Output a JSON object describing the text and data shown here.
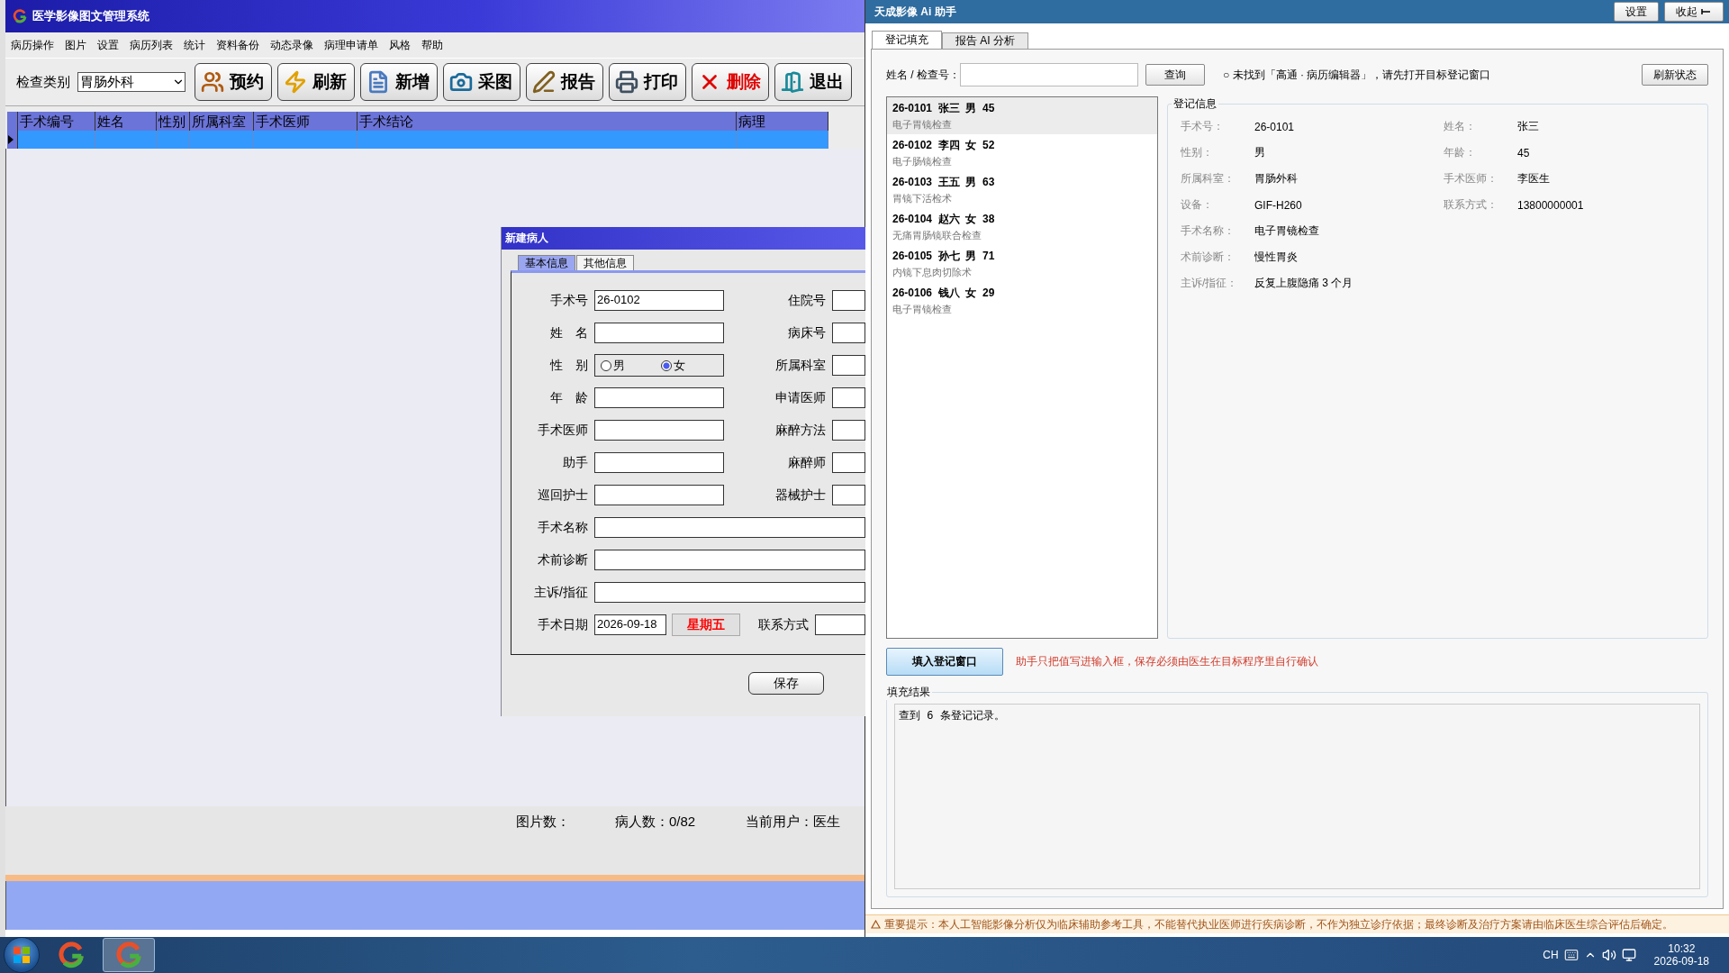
{
  "main_window": {
    "title": "医学影像图文管理系统",
    "menu": [
      "病历操作",
      "图片",
      "设置",
      "病历列表",
      "统计",
      "资料备份",
      "动态录像",
      "病理申请单",
      "风格",
      "帮助"
    ],
    "toolbar": {
      "category_label": "检查类别",
      "category_value": "胃肠外科",
      "buttons": [
        {
          "label": "预约",
          "kind": "appointment"
        },
        {
          "label": "刷新",
          "kind": "refresh"
        },
        {
          "label": "新增",
          "kind": "new"
        },
        {
          "label": "采图",
          "kind": "capture"
        },
        {
          "label": "报告",
          "kind": "report"
        },
        {
          "label": "打印",
          "kind": "print"
        },
        {
          "label": "删除",
          "kind": "delete"
        },
        {
          "label": "退出",
          "kind": "exit"
        }
      ]
    },
    "table": {
      "columns": [
        "手术编号",
        "姓名",
        "性别",
        "所属科室",
        "手术医师",
        "手术结论",
        "病理"
      ],
      "rows": [
        {
          "selected": true
        }
      ]
    },
    "status": [
      "图片数：",
      "病人数：0/82",
      "当前用户：医生"
    ]
  },
  "dialog": {
    "title": "新建病人",
    "tabs": [
      {
        "label": "基本信息",
        "selected": true
      },
      {
        "label": "其他信息",
        "selected": false
      }
    ],
    "rows": [
      {
        "kind": "pair",
        "label": "手术号",
        "value": "26-0102",
        "right": "住院号"
      },
      {
        "kind": "pair",
        "label": "姓　名",
        "right": "病床号"
      },
      {
        "kind": "gender",
        "label": "性　别",
        "options": [
          {
            "label": "男",
            "selected": false
          },
          {
            "label": "女",
            "selected": true
          }
        ],
        "right": "所属科室"
      },
      {
        "kind": "pair",
        "label": "年　龄",
        "right": "申请医师"
      },
      {
        "kind": "pair",
        "label": "手术医师",
        "right": "麻醉方法"
      },
      {
        "kind": "pair",
        "label": "助手",
        "right": "麻醉师"
      },
      {
        "kind": "pair",
        "label": "巡回护士",
        "right": "器械护士"
      },
      {
        "kind": "wide",
        "label": "手术名称"
      },
      {
        "kind": "wide",
        "label": "术前诊断"
      },
      {
        "kind": "wide",
        "label": "主诉/指征"
      },
      {
        "kind": "date",
        "label": "手术日期",
        "value": "2026-09-18",
        "weekday": "星期五",
        "right": "联系方式"
      }
    ],
    "save_button": "保存"
  },
  "assistant": {
    "title": "天成影像 Ai 助手",
    "settings_button": "设置",
    "collapse_button": "收起",
    "tabs": [
      {
        "label": "登记填充",
        "selected": true
      },
      {
        "label": "报告 AI 分析",
        "selected": false
      }
    ],
    "search_label": "姓名 / 检查号：",
    "search_button": "查询",
    "status_text": "○ 未找到「高通 · 病历编辑器」，请先打开目标登记窗口",
    "refresh_button": "刷新状态",
    "records": [
      {
        "title": "26-0101  张三  男  45",
        "exam": "电子胃镜检查",
        "selected": true
      },
      {
        "title": "26-0102  李四  女  52",
        "exam": "电子肠镜检查",
        "selected": false
      },
      {
        "title": "26-0103  王五  男  63",
        "exam": "胃镜下活检术",
        "selected": false
      },
      {
        "title": "26-0104  赵六  女  38",
        "exam": "无痛胃肠镜联合检查",
        "selected": false
      },
      {
        "title": "26-0105  孙七  男  71",
        "exam": "内镜下息肉切除术",
        "selected": false
      },
      {
        "title": "26-0106  钱八  女  29",
        "exam": "电子胃镜检查",
        "selected": false
      }
    ],
    "details": {
      "title": "登记信息",
      "rows": [
        [
          {
            "label": "手术号：",
            "value": "26-0101"
          },
          {
            "label": "姓名：",
            "value": "张三"
          }
        ],
        [
          {
            "label": "性别：",
            "value": "男"
          },
          {
            "label": "年龄：",
            "value": "45"
          }
        ],
        [
          {
            "label": "所属科室：",
            "value": "胃肠外科"
          },
          {
            "label": "手术医师：",
            "value": "李医生"
          }
        ],
        [
          {
            "label": "设备：",
            "value": "GIF-H260"
          },
          {
            "label": "联系方式：",
            "value": "13800000001"
          }
        ],
        [
          {
            "label": "手术名称：",
            "value": "电子胃镜检查"
          }
        ],
        [
          {
            "label": "术前诊断：",
            "value": "慢性胃炎"
          }
        ],
        [
          {
            "label": "主诉/指征：",
            "value": "反复上腹隐痛 3 个月"
          }
        ]
      ]
    },
    "fill_button": "填入登记窗口",
    "fill_note": "助手只把值写进输入框，保存必须由医生在目标程序里自行确认",
    "result_title": "填充结果",
    "result_text": "查到 6 条登记记录。",
    "warning": "重要提示：本人工智能影像分析仅为临床辅助参考工具，不能替代执业医师进行疾病诊断，不作为独立诊疗依据；最终诊断及治疗方案请由临床医生综合评估后确定。"
  },
  "taskbar": {
    "apps": [
      {
        "selected": false
      },
      {
        "selected": true
      }
    ],
    "language": "CH",
    "time": "10:32",
    "date": "2026-09-18"
  }
}
